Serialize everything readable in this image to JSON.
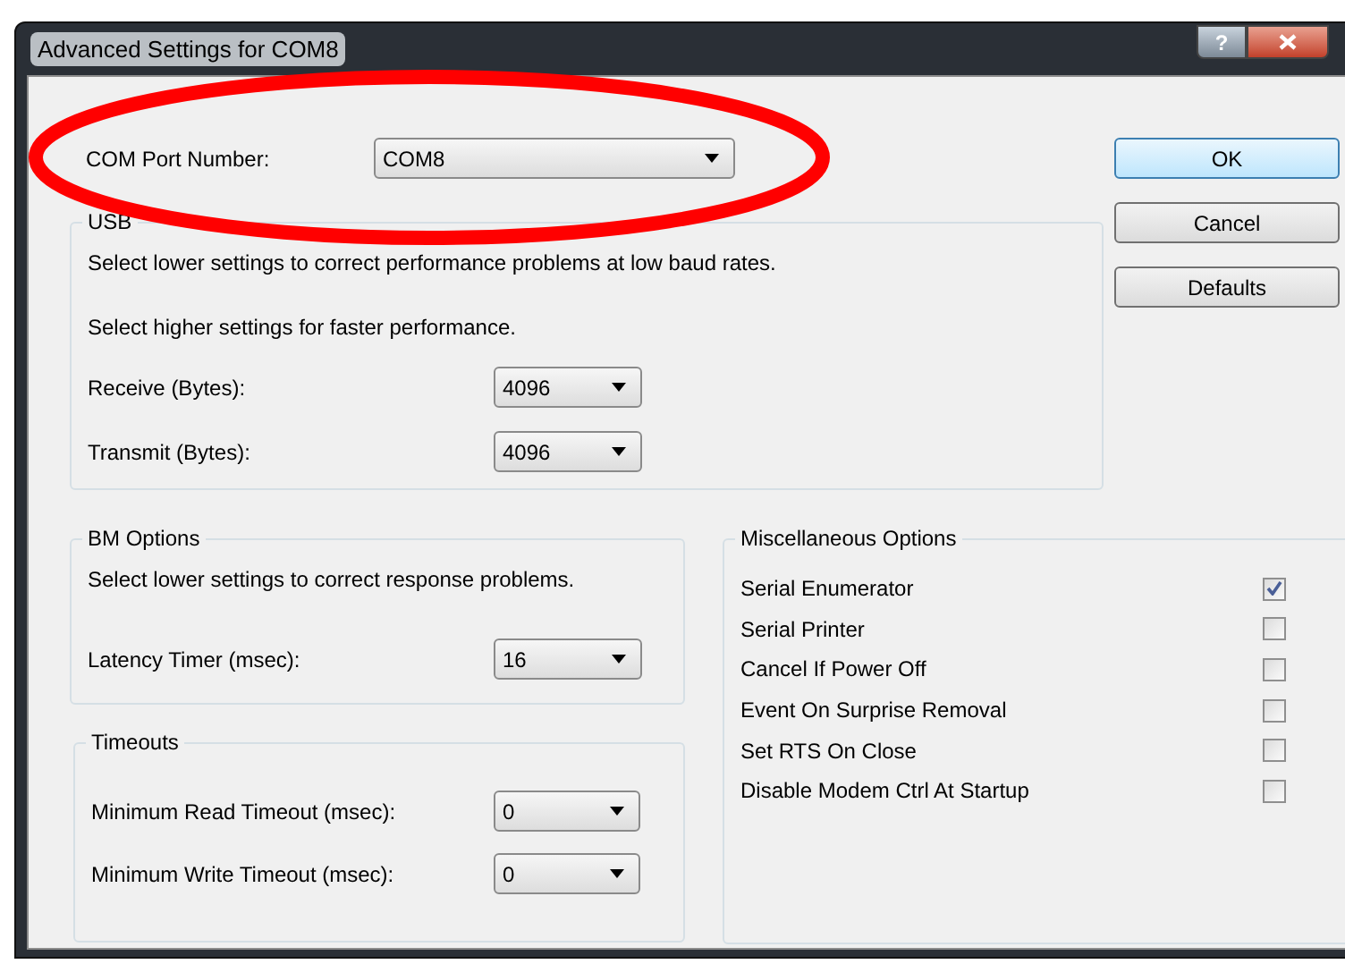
{
  "window": {
    "title": "Advanced Settings for COM8",
    "help_glyph": "?"
  },
  "com_port": {
    "label": "COM Port Number:",
    "value": "COM8"
  },
  "buttons": [
    {
      "label": "OK",
      "default": true
    },
    {
      "label": "Cancel",
      "default": false
    },
    {
      "label": "Defaults",
      "default": false
    }
  ],
  "usb_transfer_sizes": {
    "title": "USB",
    "notes": [
      "Select lower settings to correct performance problems at low baud rates.",
      "Select higher settings for faster performance."
    ],
    "fields": [
      {
        "label": "Receive (Bytes):",
        "value": "4096"
      },
      {
        "label": "Transmit (Bytes):",
        "value": "4096"
      }
    ]
  },
  "bm_options": {
    "title": "BM Options",
    "note": "Select lower settings to correct response problems.",
    "fields": [
      {
        "label": "Latency Timer (msec):",
        "value": "16"
      }
    ]
  },
  "timeouts": {
    "title": "Timeouts",
    "fields": [
      {
        "label": "Minimum Read Timeout (msec):",
        "value": "0"
      },
      {
        "label": "Minimum Write Timeout (msec):",
        "value": "0"
      }
    ]
  },
  "misc_options": {
    "title": "Miscellaneous Options",
    "items": [
      {
        "label": "Serial Enumerator",
        "checked": true
      },
      {
        "label": "Serial Printer",
        "checked": false
      },
      {
        "label": "Cancel If Power Off",
        "checked": false
      },
      {
        "label": "Event On Surprise Removal",
        "checked": false
      },
      {
        "label": "Set RTS On Close",
        "checked": false
      },
      {
        "label": "Disable Modem Ctrl At Startup",
        "checked": false
      }
    ]
  }
}
